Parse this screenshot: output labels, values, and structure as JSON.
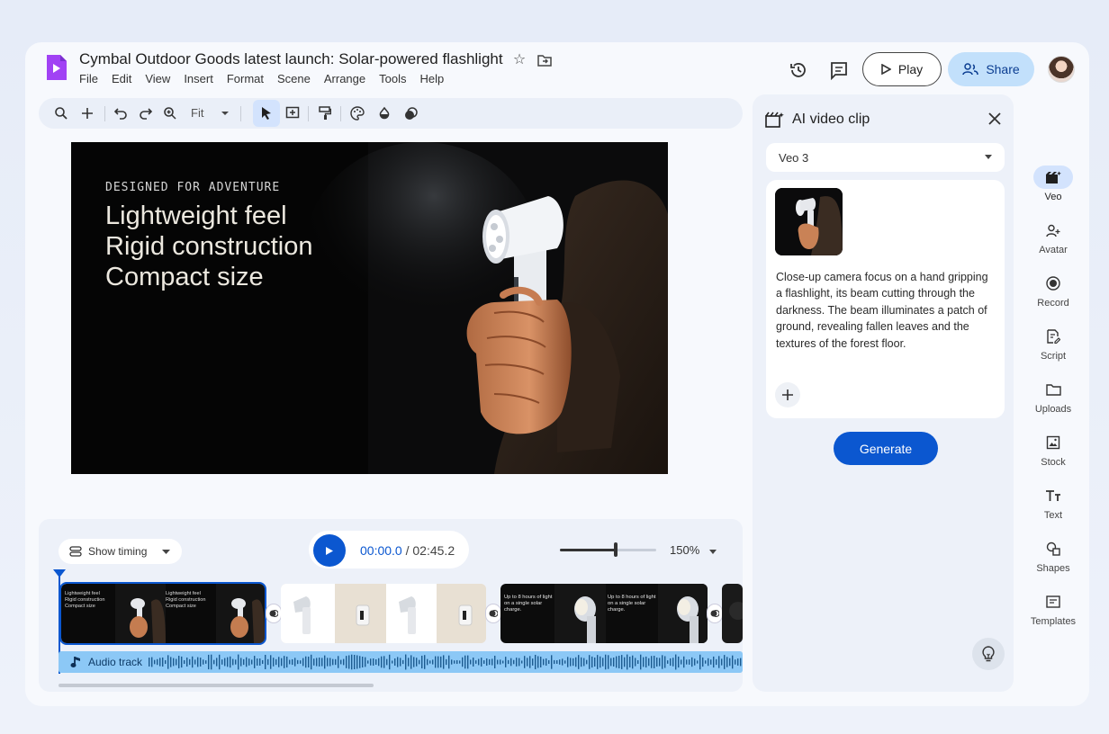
{
  "header": {
    "doc_title": "Cymbal Outdoor Goods latest launch: Solar-powered flashlight",
    "menu": [
      "File",
      "Edit",
      "View",
      "Insert",
      "Format",
      "Scene",
      "Arrange",
      "Tools",
      "Help"
    ],
    "play_label": "Play",
    "share_label": "Share"
  },
  "toolbar": {
    "zoom_fit": "Fit"
  },
  "slide": {
    "kicker": "DESIGNED FOR ADVENTURE",
    "lines": [
      "Lightweight feel",
      "Rigid construction",
      "Compact size"
    ]
  },
  "timeline": {
    "show_timing": "Show timing",
    "current_time": "00:00.0",
    "total_time": "/ 02:45.2",
    "zoom": "150%",
    "zoom_level": 0.58,
    "audio_label": "Audio track",
    "clips": [
      {
        "caption": "Lightweight feel Rigid construction Compact size",
        "kicker": "DESIGNED FOR ADVENTURE"
      },
      {
        "caption": ""
      },
      {
        "caption": "Up to 8 hours of light on a single solar charge.",
        "kicker": "SOLAR POWERED"
      },
      {
        "caption": ""
      }
    ]
  },
  "panel": {
    "title": "AI video clip",
    "model": "Veo 3",
    "prompt": "Close-up camera focus on a hand gripping a flashlight, its beam cutting through the darkness. The beam illuminates a patch of ground, revealing fallen leaves and the textures of the forest floor.",
    "generate_label": "Generate"
  },
  "rail": [
    {
      "label": "Veo",
      "icon": "veo-icon"
    },
    {
      "label": "Avatar",
      "icon": "avatar-icon"
    },
    {
      "label": "Record",
      "icon": "record-icon"
    },
    {
      "label": "Script",
      "icon": "script-icon"
    },
    {
      "label": "Uploads",
      "icon": "folder-icon"
    },
    {
      "label": "Stock",
      "icon": "stock-icon"
    },
    {
      "label": "Text",
      "icon": "text-icon"
    },
    {
      "label": "Shapes",
      "icon": "shapes-icon"
    },
    {
      "label": "Templates",
      "icon": "templates-icon"
    }
  ],
  "colors": {
    "accent": "#0b57d0",
    "share_bg": "#c2e0fb",
    "audio": "#8cc8f6",
    "logo": "#a142f4"
  }
}
